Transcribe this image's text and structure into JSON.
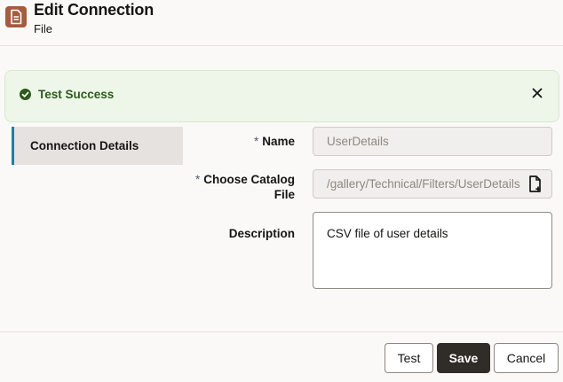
{
  "header": {
    "title": "Edit Connection",
    "subtitle": "File",
    "icon": "document-icon",
    "icon_color": "#a65b3f"
  },
  "banner": {
    "text": "Test Success",
    "status_color": "#2c5a1c",
    "close_icon": "close-icon"
  },
  "nav": {
    "items": [
      {
        "label": "Connection Details",
        "selected": true
      }
    ],
    "accent": "#227e9e"
  },
  "form": {
    "required_mark": "*",
    "name": {
      "label": "Name",
      "value": "UserDetails",
      "required": true,
      "disabled": true
    },
    "catalog_file": {
      "label_line1": "Choose Catalog",
      "label_line2": "File",
      "value": "/gallery/Technical/Filters/UserDetails",
      "required": true,
      "disabled": true,
      "action_icon": "file-picker-icon"
    },
    "description": {
      "label": "Description",
      "value": "CSV file of user details"
    }
  },
  "footer": {
    "test_label": "Test",
    "save_label": "Save",
    "cancel_label": "Cancel",
    "primary_color": "#302c28"
  }
}
